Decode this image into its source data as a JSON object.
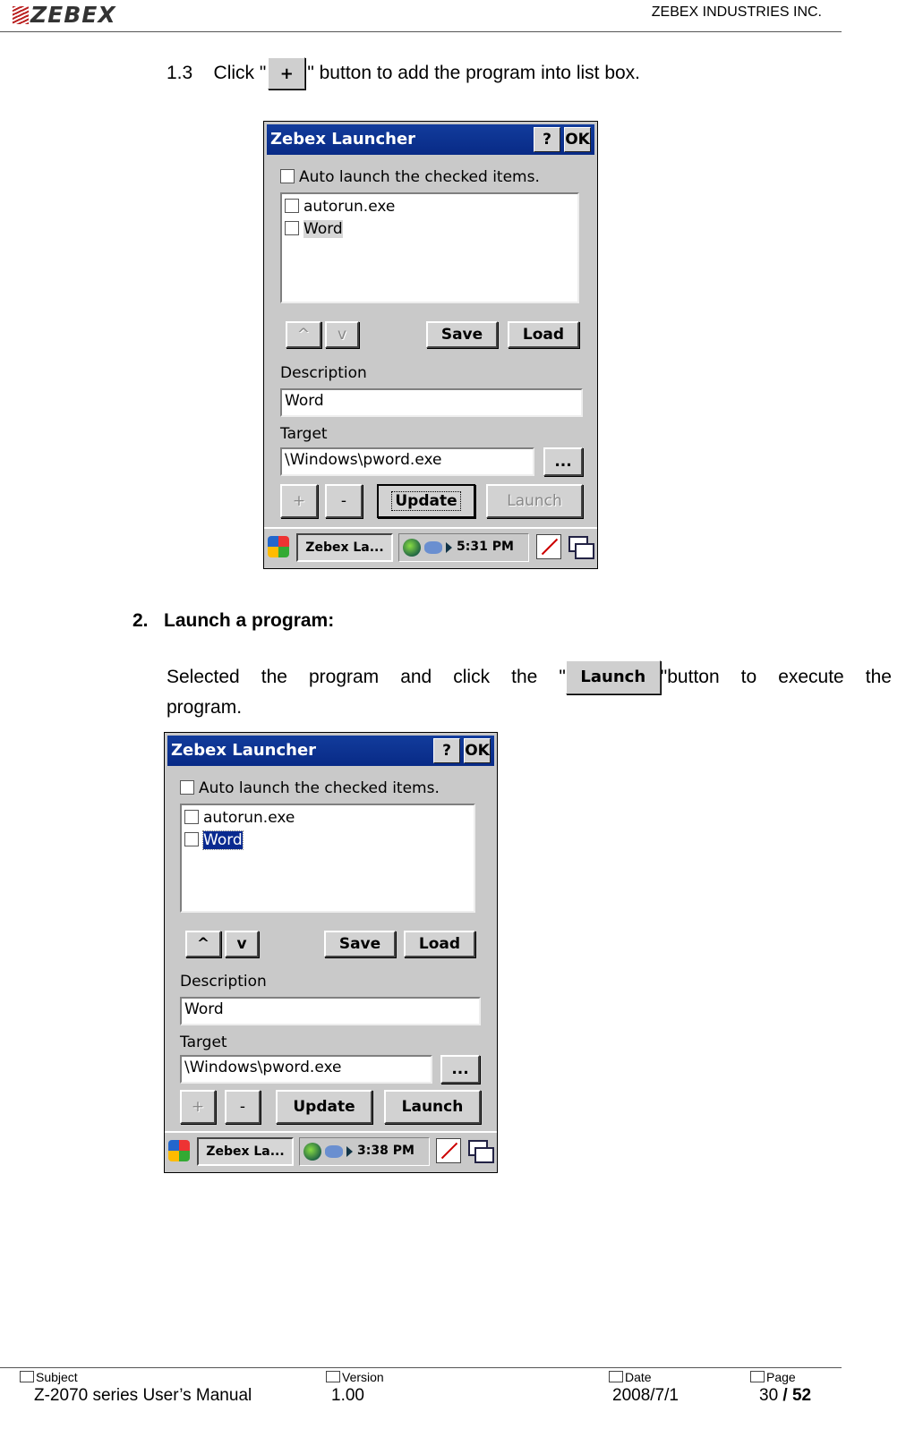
{
  "header": {
    "logo": "ZEBEX",
    "company": "ZEBEX INDUSTRIES INC."
  },
  "step13": {
    "number": "1.3",
    "before": "Click \"",
    "button": "+",
    "after": "\" button to add the program into list box."
  },
  "section2": {
    "heading": "2.   Launch a program:",
    "para_words": [
      "Selected",
      "the",
      "program",
      "and",
      "click",
      "the",
      "\""
    ],
    "launch_btn": "Launch",
    "para_after": [
      "\"button",
      "to",
      "execute",
      "the"
    ],
    "para_line2": "program."
  },
  "shot1": {
    "title": "Zebex Launcher",
    "help": "?",
    "ok": "OK",
    "auto": "Auto launch the checked items.",
    "items": [
      "autorun.exe",
      "Word"
    ],
    "up": "^",
    "down": "v",
    "save": "Save",
    "load": "Load",
    "desc_label": "Description",
    "desc_value": "Word",
    "target_label": "Target",
    "target_value": "\\Windows\\pword.exe",
    "browse": "...",
    "plus": "+",
    "minus": "-",
    "update": "Update",
    "launch": "Launch",
    "task": "Zebex La...",
    "time": "5:31 PM"
  },
  "shot2": {
    "title": "Zebex Launcher",
    "help": "?",
    "ok": "OK",
    "auto": "Auto launch the checked items.",
    "items": [
      "autorun.exe",
      "Word"
    ],
    "up": "^",
    "down": "v",
    "save": "Save",
    "load": "Load",
    "desc_label": "Description",
    "desc_value": "Word",
    "target_label": "Target",
    "target_value": "\\Windows\\pword.exe",
    "browse": "...",
    "plus": "+",
    "minus": "-",
    "update": "Update",
    "launch": "Launch",
    "task": "Zebex La...",
    "time": "3:38 PM"
  },
  "footer": {
    "subject_label": "Subject",
    "subject": "Z-2070 series User’s Manual",
    "version_label": "Version",
    "version": "1.00",
    "date_label": "Date",
    "date": "2008/7/1",
    "page_label": "Page",
    "page": "30",
    "page_sep": " / ",
    "page_total": "52"
  }
}
